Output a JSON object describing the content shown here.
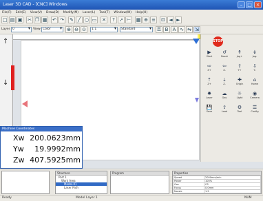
{
  "window": {
    "title": "Laser 3D CAD - [CNC] Windows"
  },
  "menu": [
    "File(F)",
    "Edit(E)",
    "View(V)",
    "Draw(D)",
    "Modify(M)",
    "Laser(L)",
    "Tool(T)",
    "Window(W)",
    "Help(H)"
  ],
  "toolbar": {
    "tag_label": "XY Plane",
    "combo_layer": "0",
    "combo_color": "Color",
    "combo_scale": "1:1",
    "combo_mode": "Standard",
    "label_layer": "Layer",
    "label_view": "View"
  },
  "coords": {
    "title": "Machine Coordinates",
    "xw_label": "Xw",
    "xw_value": "200.0623mm",
    "yw_label": "Yw",
    "yw_value": "19.9992mm",
    "zw_label": "Zw",
    "zw_value": "407.5925mm"
  },
  "right_panel": {
    "stop_label": "STOP",
    "icons": [
      {
        "name": "start",
        "label": "Start"
      },
      {
        "name": "reset",
        "label": "Reset"
      },
      {
        "name": "jog-plus",
        "label": "Jog+"
      },
      {
        "name": "jog-minus",
        "label": "Jog-"
      },
      {
        "name": "x-plus",
        "label": "X+"
      },
      {
        "name": "x-minus",
        "label": "X-"
      },
      {
        "name": "y-plus",
        "label": "Y+"
      },
      {
        "name": "y-minus",
        "label": "Y-"
      },
      {
        "name": "z-plus",
        "label": "Z+"
      },
      {
        "name": "z-minus",
        "label": "Z-"
      },
      {
        "name": "origin",
        "label": "Origin"
      },
      {
        "name": "home",
        "label": "Home"
      },
      {
        "name": "laser",
        "label": "Laser"
      },
      {
        "name": "gas",
        "label": "Gas"
      },
      {
        "name": "light",
        "label": "Light"
      },
      {
        "name": "camera",
        "label": "Camera"
      },
      {
        "name": "save",
        "label": "Save"
      },
      {
        "name": "load",
        "label": "Load"
      },
      {
        "name": "tool",
        "label": "Tool"
      },
      {
        "name": "config",
        "label": "Config"
      }
    ]
  },
  "bottom": {
    "tree_title": "Structure",
    "tree_items": [
      "Part 1",
      "Work Area",
      "Model-01",
      "Laser Path"
    ],
    "list_title": "Program",
    "props_title": "Properties",
    "props_rows": [
      [
        "Speed",
        "2000mm/min"
      ],
      [
        "Power",
        "100%"
      ],
      [
        "Gas",
        "O2"
      ],
      [
        "Focus",
        "0.0mm"
      ],
      [
        "Nozzle",
        "1.5"
      ]
    ]
  },
  "status": {
    "left": "Ready",
    "center": "Model  Layer 1",
    "right": "NUM"
  },
  "colors": {
    "stop": "#e02a1c",
    "accent": "#2d6fd6",
    "redbar": "#e02020"
  }
}
